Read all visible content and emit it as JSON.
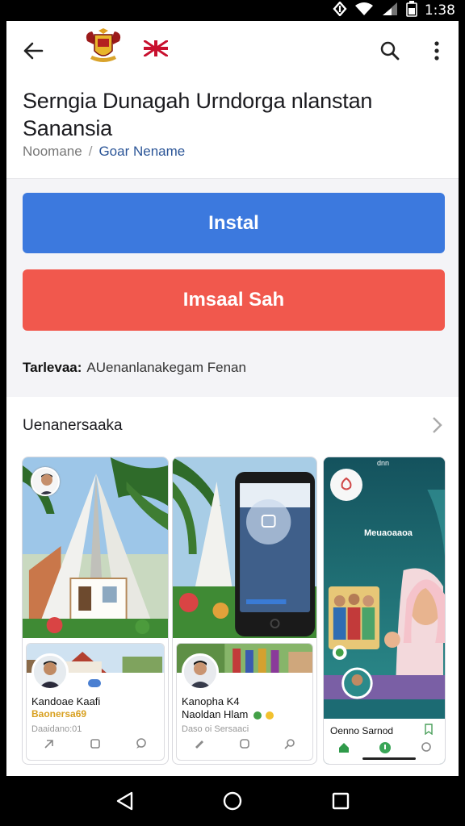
{
  "status": {
    "time": "1:38"
  },
  "header": {
    "title": "Serngia Dunagah Urndorga nlanstan Sanansia",
    "breadcrumb": {
      "parent": "Noomane",
      "separator": "/",
      "current": "Goar Nename"
    }
  },
  "actions": {
    "install_label": "Instal",
    "install_alt_label": "Imsaal Sah"
  },
  "meta": {
    "label": "Tarlevaa:",
    "value": "AUenanlanakegam Fenan"
  },
  "section": {
    "title": "Uenanersaaka"
  },
  "cards": [
    {
      "name": "Kandoae Kaafi",
      "sub": "Baonersa69",
      "small": "Daaidano:01"
    },
    {
      "name": "Kanopha K4",
      "sub2": "Naoldan Hlam",
      "small": "Daso oi    Sersaaci"
    },
    {
      "overlay_text": "Meuaoaaoa",
      "status_text": "dnn",
      "name": "Oenno Sarnod"
    }
  ],
  "colors": {
    "install": "#3c79de",
    "install_alt": "#f1584d",
    "accent_link": "#2b5597"
  },
  "icons": [
    "back-arrow-icon",
    "search-icon",
    "more-vert-icon",
    "chevron-right-icon",
    "nav-back-icon",
    "nav-home-icon",
    "nav-recents-icon"
  ]
}
